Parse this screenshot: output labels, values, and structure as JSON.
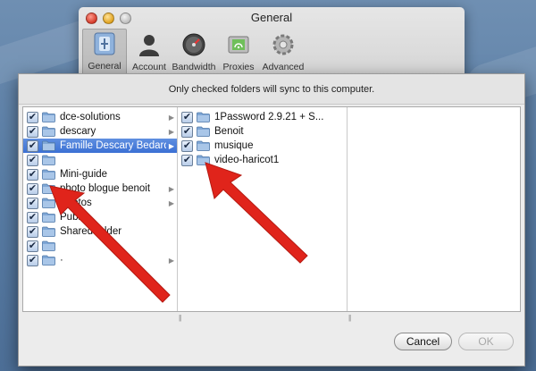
{
  "window": {
    "title": "General",
    "toolbar": [
      {
        "label": "General",
        "icon": "general-icon",
        "active": true
      },
      {
        "label": "Account",
        "icon": "account-icon",
        "active": false
      },
      {
        "label": "Bandwidth",
        "icon": "bandwidth-icon",
        "active": false
      },
      {
        "label": "Proxies",
        "icon": "proxies-icon",
        "active": false
      },
      {
        "label": "Advanced",
        "icon": "advanced-icon",
        "active": false
      }
    ]
  },
  "sheet": {
    "info": "Only checked folders will sync to this computer.",
    "column1": [
      {
        "label": "dce-solutions",
        "checked": true,
        "has_arrow": true
      },
      {
        "label": "descary",
        "checked": true,
        "has_arrow": true
      },
      {
        "label": "Famille Descary Bedard",
        "checked": true,
        "has_arrow": true,
        "selected": true
      },
      {
        "label": "",
        "checked": true,
        "has_arrow": false
      },
      {
        "label": "Mini-guide",
        "checked": true,
        "has_arrow": false
      },
      {
        "label": "photo blogue benoit",
        "checked": true,
        "has_arrow": true
      },
      {
        "label": "Photos",
        "checked": true,
        "has_arrow": true
      },
      {
        "label": "Public",
        "checked": true,
        "has_arrow": false
      },
      {
        "label": "Shared folder",
        "checked": true,
        "has_arrow": false
      },
      {
        "label": "",
        "checked": true,
        "has_arrow": false
      },
      {
        "label": "·",
        "checked": true,
        "has_arrow": true
      }
    ],
    "column2": [
      {
        "label": "1Password 2.9.21 + S...",
        "checked": true
      },
      {
        "label": "Benoit",
        "checked": true
      },
      {
        "label": "musique",
        "checked": true
      },
      {
        "label": "video-haricot1",
        "checked": true
      }
    ],
    "cancel_label": "Cancel",
    "ok_label": "OK"
  },
  "colors": {
    "selection": "#3b70d4",
    "annotation_arrow": "#e0241b",
    "folder": "#7fa7d6"
  }
}
